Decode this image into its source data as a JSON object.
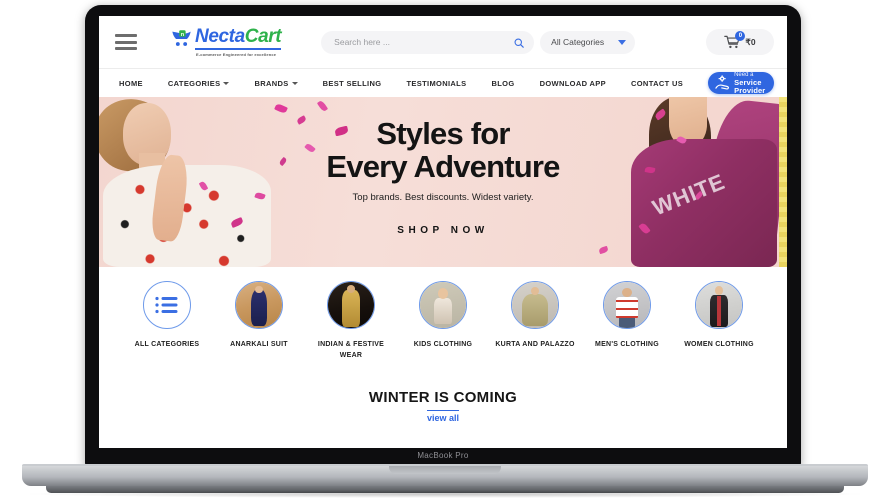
{
  "device": {
    "label": "MacBook Pro"
  },
  "header": {
    "menu_icon": "hamburger-icon",
    "logo": {
      "mark": "shopping-cart-logo-icon",
      "name_part1": "Necta",
      "name_part2": "Cart",
      "tagline": "E-commerce Engineered for excellence"
    },
    "search": {
      "placeholder": "Search here ...",
      "value": "",
      "icon": "search-icon"
    },
    "category_select": {
      "selected": "All Categories",
      "caret_icon": "chevron-down-icon"
    },
    "cart": {
      "icon": "shopping-cart-icon",
      "badge_count": "0",
      "total": "₹0"
    }
  },
  "nav": {
    "items": [
      {
        "label": "HOME",
        "has_caret": false
      },
      {
        "label": "CATEGORIES",
        "has_caret": true
      },
      {
        "label": "BRANDS",
        "has_caret": true
      },
      {
        "label": "BEST SELLING",
        "has_caret": false
      },
      {
        "label": "TESTIMONIALS",
        "has_caret": false
      },
      {
        "label": "BLOG",
        "has_caret": false
      },
      {
        "label": "DOWNLOAD APP",
        "has_caret": false
      },
      {
        "label": "CONTACT US",
        "has_caret": false
      }
    ],
    "service_provider": {
      "line1": "Need a",
      "line2": "Service Provider",
      "icon1": "gear-icon",
      "icon2": "hand-offer-icon"
    }
  },
  "hero": {
    "title_line1": "Styles for",
    "title_line2": "Every Adventure",
    "subtitle": "Top brands. Best discounts. Widest variety.",
    "cta": "SHOP NOW",
    "model_right_print": "WHITE",
    "background_color": "#f3d6cf"
  },
  "categories": [
    {
      "label": "ALL CATEGORIES",
      "thumb": "list-icon"
    },
    {
      "label": "ANARKALI SUIT",
      "thumb": "anarkali-suit-photo"
    },
    {
      "label": "INDIAN & FESTIVE WEAR",
      "thumb": "indian-festive-wear-photo"
    },
    {
      "label": "KIDS CLOTHING",
      "thumb": "kids-clothing-photo"
    },
    {
      "label": "KURTA AND PALAZZO",
      "thumb": "kurta-palazzo-photo"
    },
    {
      "label": "MEN'S CLOTHING",
      "thumb": "mens-clothing-photo"
    },
    {
      "label": "WOMEN CLOTHING",
      "thumb": "women-clothing-photo"
    }
  ],
  "promo": {
    "title": "WINTER IS COMING",
    "view_all": "view all"
  },
  "colors": {
    "brand_blue": "#2f66e0",
    "brand_green": "#2fb24b",
    "hero_pink": "#f3d6cf",
    "link_blue": "#2f66e0"
  }
}
